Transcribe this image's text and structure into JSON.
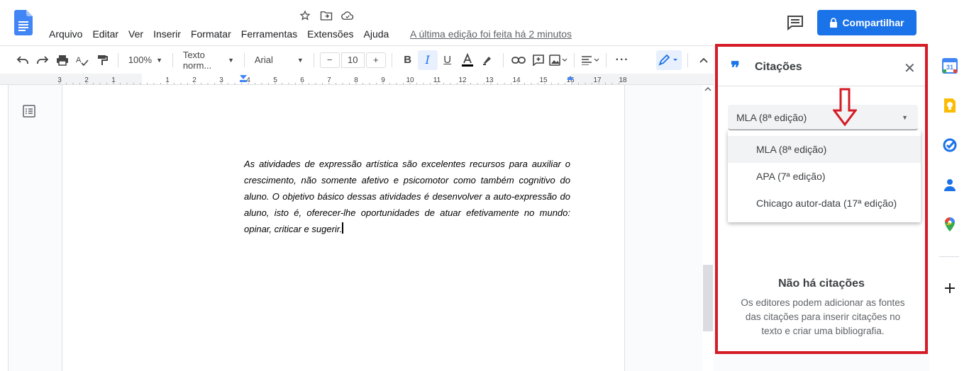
{
  "menu": {
    "items": [
      "Arquivo",
      "Editar",
      "Ver",
      "Inserir",
      "Formatar",
      "Ferramentas",
      "Extensões",
      "Ajuda"
    ]
  },
  "last_edit": "A última edição foi feita há 2 minutos",
  "share": {
    "label": "Compartilhar"
  },
  "toolbar": {
    "zoom": "100%",
    "style": "Texto norm...",
    "font": "Arial",
    "font_size": "10",
    "minus": "−",
    "plus": "+"
  },
  "ruler": {
    "numbers": [
      "3",
      "2",
      "1",
      "1",
      "2",
      "3",
      "4",
      "5",
      "6",
      "7",
      "8",
      "9",
      "10",
      "11",
      "12",
      "13",
      "14",
      "15",
      "16",
      "17",
      "18"
    ]
  },
  "document": {
    "body": "As atividades de expressão artística são excelentes recursos para auxiliar o crescimento, não somente afetivo e psicomotor como também cognitivo do aluno. O objetivo básico dessas atividades é desenvolver a auto-expressão do aluno, isto é, oferecer-lhe oportunidades de atuar efetivamente no mundo: opinar, criticar e sugerir."
  },
  "citations": {
    "title": "Citações",
    "selected_style": "MLA (8ª edição)",
    "options": [
      "MLA (8ª edição)",
      "APA (7ª edição)",
      "Chicago autor-data (17ª edição)"
    ],
    "empty_title": "Não há citações",
    "empty_desc": "Os editores podem adicionar as fontes das citações para inserir citações no texto e criar uma bibliografia."
  },
  "colors": {
    "accent": "#1a73e8",
    "highlight_border": "#d41b26"
  }
}
